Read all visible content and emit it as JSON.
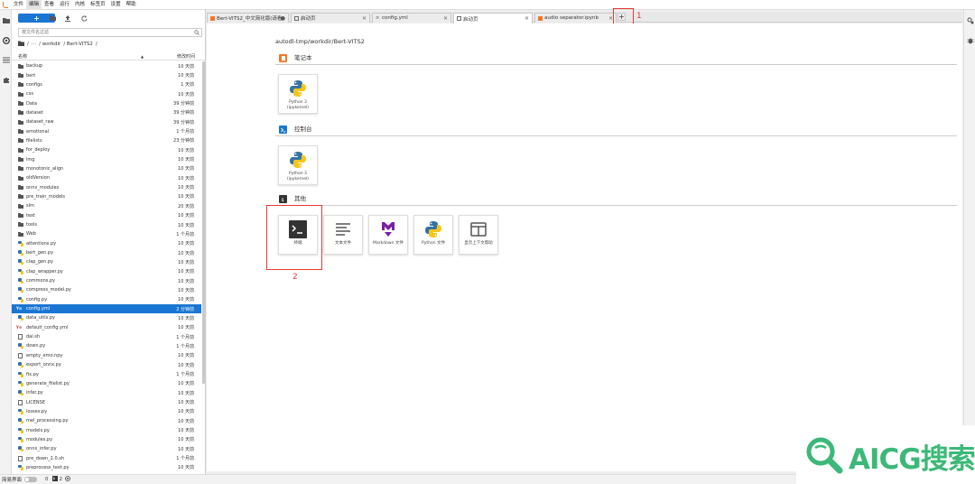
{
  "menu": [
    "文件",
    "编辑",
    "查看",
    "运行",
    "内核",
    "标签页",
    "设置",
    "帮助"
  ],
  "active_menu_index": 1,
  "browser": {
    "new_label": "+",
    "filter_placeholder": "按文件名过滤",
    "breadcrumbs": [
      "/",
      "···",
      "/ workdir",
      "/ Bert-VITS2",
      "/"
    ],
    "col_name": "名称",
    "col_time": "修改时间",
    "files": [
      {
        "name": "backup",
        "type": "folder",
        "time": "10 天前"
      },
      {
        "name": "bert",
        "type": "folder",
        "time": "10 天前"
      },
      {
        "name": "configs",
        "type": "folder",
        "time": "1 天前"
      },
      {
        "name": "css",
        "type": "folder",
        "time": "10 天前"
      },
      {
        "name": "Data",
        "type": "folder",
        "time": "39 分钟前"
      },
      {
        "name": "dataset",
        "type": "folder",
        "time": "39 分钟前"
      },
      {
        "name": "dataset_raw",
        "type": "folder",
        "time": "39 分钟前"
      },
      {
        "name": "emotional",
        "type": "folder",
        "time": "1 个月前"
      },
      {
        "name": "filelists",
        "type": "folder",
        "time": "23 分钟前"
      },
      {
        "name": "for_deploy",
        "type": "folder",
        "time": "10 天前"
      },
      {
        "name": "img",
        "type": "folder",
        "time": "10 天前"
      },
      {
        "name": "monotonic_align",
        "type": "folder",
        "time": "10 天前"
      },
      {
        "name": "oldVersion",
        "type": "folder",
        "time": "10 天前"
      },
      {
        "name": "onnx_modules",
        "type": "folder",
        "time": "10 天前"
      },
      {
        "name": "pre_train_models",
        "type": "folder",
        "time": "10 天前"
      },
      {
        "name": "slm",
        "type": "folder",
        "time": "20 天前"
      },
      {
        "name": "text",
        "type": "folder",
        "time": "10 天前"
      },
      {
        "name": "tools",
        "type": "folder",
        "time": "10 天前"
      },
      {
        "name": "Web",
        "type": "folder",
        "time": "1 个月前"
      },
      {
        "name": "attentions.py",
        "type": "py",
        "time": "10 天前"
      },
      {
        "name": "bert_gen.py",
        "type": "py",
        "time": "10 天前"
      },
      {
        "name": "clap_gen.py",
        "type": "py",
        "time": "10 天前"
      },
      {
        "name": "clap_wrapper.py",
        "type": "py",
        "time": "10 天前"
      },
      {
        "name": "commons.py",
        "type": "py",
        "time": "10 天前"
      },
      {
        "name": "compress_model.py",
        "type": "py",
        "time": "10 天前"
      },
      {
        "name": "config.py",
        "type": "py",
        "time": "10 天前"
      },
      {
        "name": "config.yml",
        "type": "yml",
        "time": "2 分钟前",
        "selected": true
      },
      {
        "name": "data_utils.py",
        "type": "py",
        "time": "10 天前"
      },
      {
        "name": "default_config.yml",
        "type": "yml",
        "time": "10 天前"
      },
      {
        "name": "dal.sh",
        "type": "file",
        "time": "1 个月前"
      },
      {
        "name": "down.py",
        "type": "py",
        "time": "1 个月前"
      },
      {
        "name": "empty_emo.npy",
        "type": "npy",
        "time": "10 天前"
      },
      {
        "name": "export_onnx.py",
        "type": "py",
        "time": "10 天前"
      },
      {
        "name": "fix.py",
        "type": "py",
        "time": "1 个月前"
      },
      {
        "name": "generate_filelist.py",
        "type": "py",
        "time": "10 天前"
      },
      {
        "name": "infer.py",
        "type": "py",
        "time": "10 天前"
      },
      {
        "name": "LICENSE",
        "type": "file",
        "time": "10 天前"
      },
      {
        "name": "losses.py",
        "type": "py",
        "time": "10 天前"
      },
      {
        "name": "mel_processing.py",
        "type": "py",
        "time": "10 天前"
      },
      {
        "name": "models.py",
        "type": "py",
        "time": "10 天前"
      },
      {
        "name": "modules.py",
        "type": "py",
        "time": "10 天前"
      },
      {
        "name": "onnx_infer.py",
        "type": "py",
        "time": "10 天前"
      },
      {
        "name": "pre_down_2.0.sh",
        "type": "file",
        "time": "1 个月前"
      },
      {
        "name": "preprocess_text.py",
        "type": "py",
        "time": "10 天前"
      }
    ]
  },
  "tabs": [
    {
      "label": "Bert-VITS2_中文简化版(请看!",
      "icon": "nb",
      "close": "●",
      "active": false
    },
    {
      "label": "启动页",
      "icon": "launch",
      "close": "×",
      "active": false
    },
    {
      "label": "config.yml",
      "icon": "cfg",
      "close": "×",
      "active": false
    },
    {
      "label": "启动页",
      "icon": "launch",
      "close": "×",
      "active": true
    },
    {
      "label": "audio separator.ipynb",
      "icon": "nb",
      "close": "×",
      "active": false
    }
  ],
  "add_tab_label": "+",
  "annotations": {
    "one": "1",
    "two": "2"
  },
  "launcher": {
    "path": "autodl-tmp/workdir/Bert-VITS2",
    "sections": [
      {
        "title": "笔记本",
        "icon": "notebook-icon",
        "color": "#f37726",
        "cards": [
          {
            "label": "Python 3\n(ipykernel)",
            "icon": "python-icon"
          }
        ]
      },
      {
        "title": "控制台",
        "icon": "console-icon",
        "color": "#1976d2",
        "cards": [
          {
            "label": "Python 3\n(ipykernel)",
            "icon": "python-icon"
          }
        ]
      },
      {
        "title": "其他",
        "icon": "terminal-section-icon",
        "color": "#333333",
        "cards": [
          {
            "label": "终端",
            "icon": "terminal-icon"
          },
          {
            "label": "文本文件",
            "icon": "text-file-icon"
          },
          {
            "label": "Markdown 文件",
            "icon": "markdown-icon"
          },
          {
            "label": "Python 文件",
            "icon": "python-icon"
          },
          {
            "label": "显示上下文帮助",
            "icon": "context-help-icon"
          }
        ]
      }
    ]
  },
  "status": {
    "label": "简易界面",
    "count1": "0",
    "count2": "2"
  },
  "watermark": {
    "text": "AICG搜索"
  },
  "colors": {
    "accent": "#1976d2",
    "annotation": "#e53935",
    "watermark": "#3cb878"
  }
}
